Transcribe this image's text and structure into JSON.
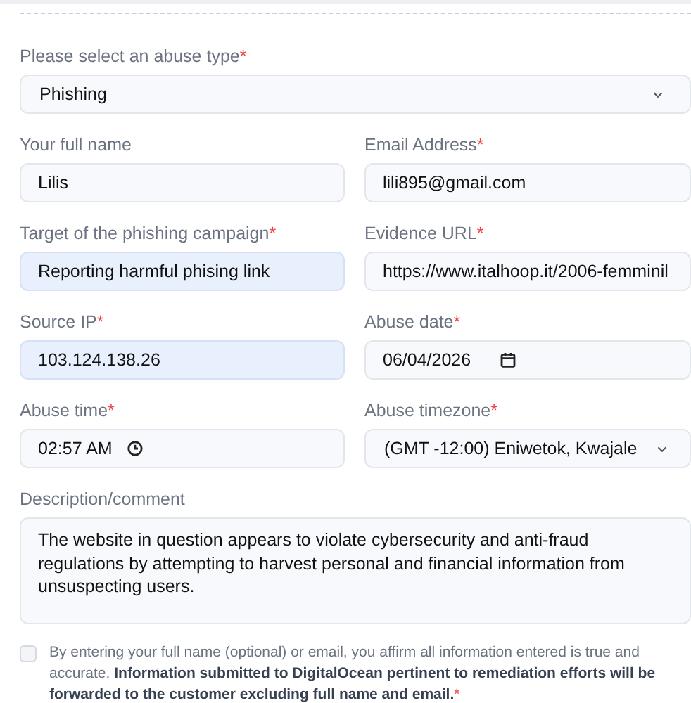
{
  "rows": [
    [
      {
        "kind": "select",
        "label": "Please select an abuse type",
        "required_mark": "*",
        "value": "Phishing",
        "autofilled": false
      }
    ],
    [
      {
        "kind": "text",
        "label": "Your full name",
        "value": "Lilis",
        "autofilled": false
      },
      {
        "kind": "text",
        "label": "Email Address",
        "required_mark": "*",
        "value": "lili895@gmail.com",
        "autofilled": false
      }
    ],
    [
      {
        "kind": "text",
        "label": "Target of the phishing campaign",
        "required_mark": "*",
        "value": "Reporting harmful phising link",
        "autofilled": true
      },
      {
        "kind": "text",
        "label": "Evidence URL",
        "required_mark": "*",
        "value": "https://www.italhoop.it/2006-femminil",
        "autofilled": false
      }
    ],
    [
      {
        "kind": "text",
        "label": "Source IP",
        "required_mark": "*",
        "value": "103.124.138.26",
        "autofilled": true
      },
      {
        "kind": "date",
        "label": "Abuse date",
        "required_mark": "*",
        "value": "06/04/2026",
        "autofilled": false
      }
    ],
    [
      {
        "kind": "time",
        "label": "Abuse time",
        "required_mark": "*",
        "value": "02:57 AM",
        "autofilled": false
      },
      {
        "kind": "select",
        "label": "Abuse timezone",
        "required_mark": "*",
        "value": "(GMT -12:00) Eniwetok, Kwajale",
        "autofilled": false
      }
    ],
    [
      {
        "kind": "textarea",
        "label": "Description/comment",
        "value": "The website in question appears to violate cybersecurity and anti-fraud regulations by attempting to harvest personal and financial information from unsuspecting users.",
        "autofilled": false
      }
    ]
  ],
  "consent": {
    "checked": false,
    "text": "By entering your full name (optional) or email, you affirm all information entered is true and accurate. **Information submitted to DigitalOcean pertinent to remediation efforts will be forwarded to the customer excluding full name and email.**",
    "required_mark": "*"
  }
}
